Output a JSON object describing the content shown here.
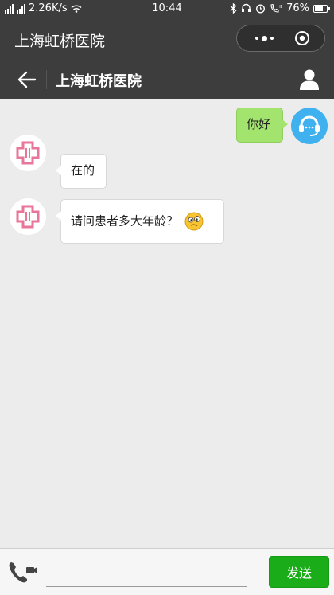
{
  "status_bar": {
    "network_speed": "2.26K/s",
    "time": "10:44",
    "battery": "76%",
    "battery_level": 0.76
  },
  "mini_program": {
    "title": "上海虹桥医院"
  },
  "nav": {
    "title": "上海虹桥医院"
  },
  "messages": [
    {
      "side": "right",
      "text": "你好"
    },
    {
      "side": "left",
      "text": "在的"
    },
    {
      "side": "left",
      "text": "请问患者多大年龄？"
    }
  ],
  "input": {
    "placeholder": "",
    "value": "",
    "send_label": "发送"
  },
  "colors": {
    "bar_bg": "#3d3d3d",
    "chat_bg": "#ececec",
    "bubble_self": "#a2e46e",
    "send_button": "#1aad19",
    "agent_avatar": "#3fb1ee",
    "hospital_cross": "#e8759a"
  }
}
